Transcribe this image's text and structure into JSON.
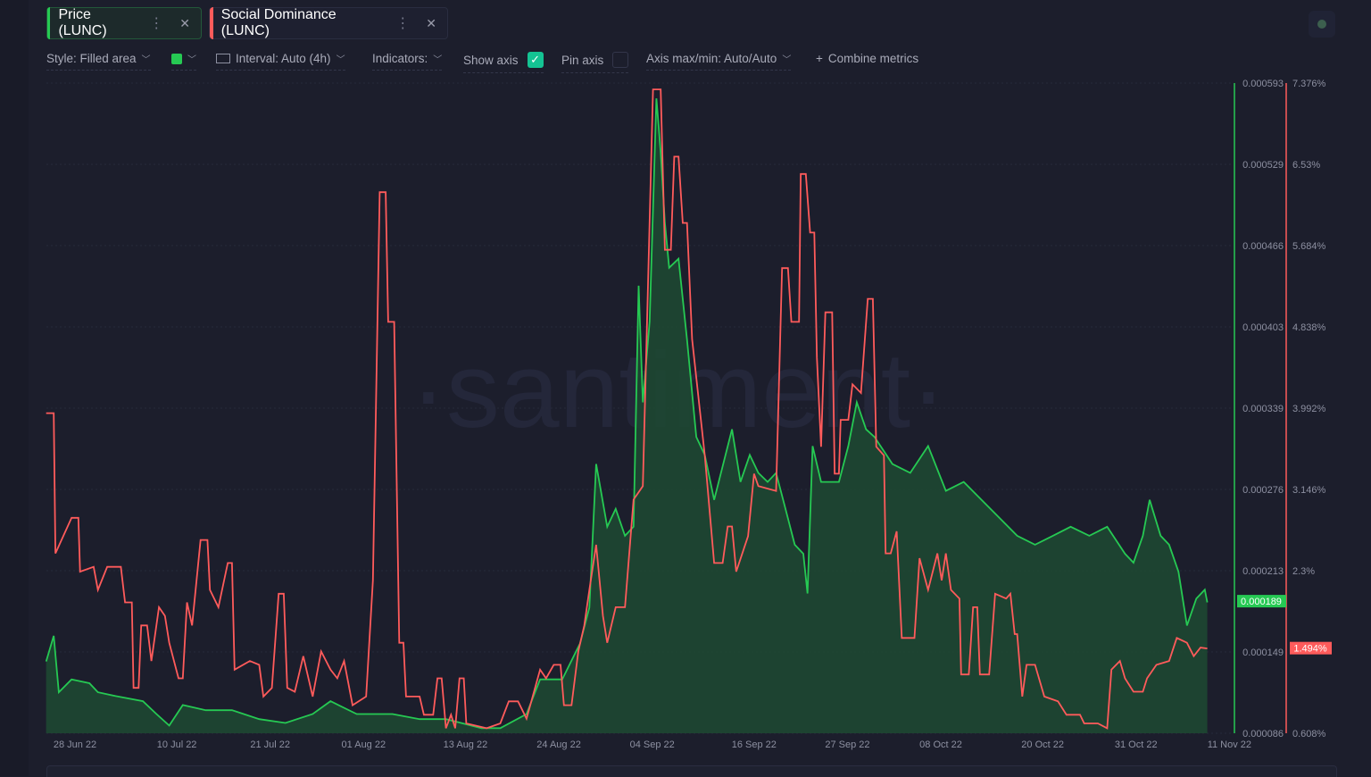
{
  "tabs": [
    {
      "label": "Price (LUNC)",
      "color": "#26c953"
    },
    {
      "label": "Social Dominance (LUNC)",
      "color": "#ff5b5b"
    }
  ],
  "toolbar": {
    "style": "Style: Filled area",
    "interval": "Interval: Auto (4h)",
    "indicators": "Indicators:",
    "show_axis": "Show axis",
    "show_axis_checked": true,
    "pin_axis": "Pin axis",
    "pin_axis_checked": false,
    "axis_maxmin": "Axis max/min: Auto/Auto",
    "combine": "Combine metrics",
    "series_color": "#26c953"
  },
  "watermark": "·santiment·",
  "chart_data": {
    "type": "area",
    "x_unit": "days since 28 Jun 22",
    "x_ticks": [
      {
        "day": 0,
        "label": "28 Jun 22"
      },
      {
        "day": 12,
        "label": "10 Jul 22"
      },
      {
        "day": 23,
        "label": "21 Jul 22"
      },
      {
        "day": 34,
        "label": "01 Aug 22"
      },
      {
        "day": 46,
        "label": "13 Aug 22"
      },
      {
        "day": 57,
        "label": "24 Aug 22"
      },
      {
        "day": 68,
        "label": "04 Sep 22"
      },
      {
        "day": 80,
        "label": "16 Sep 22"
      },
      {
        "day": 91,
        "label": "27 Sep 22"
      },
      {
        "day": 102,
        "label": "08 Oct 22"
      },
      {
        "day": 114,
        "label": "20 Oct 22"
      },
      {
        "day": 125,
        "label": "31 Oct 22"
      },
      {
        "day": 136,
        "label": "11 Nov 22"
      }
    ],
    "price_axis": {
      "min": 8.6e-05,
      "max": 0.000593,
      "ticks": [
        "0.000593",
        "0.000529",
        "0.000466",
        "0.000403",
        "0.000339",
        "0.000276",
        "0.000213",
        "0.000149",
        "0.000086"
      ],
      "current": "0.000189",
      "current_value": 0.000189,
      "color": "#26c953"
    },
    "dominance_axis": {
      "min": 0.608,
      "max": 7.376,
      "ticks": [
        "7.376%",
        "6.53%",
        "5.684%",
        "4.838%",
        "3.992%",
        "3.146%",
        "2.3%",
        "1.494%",
        "0.608%"
      ],
      "tick_values": [
        7.376,
        6.53,
        5.684,
        4.838,
        3.992,
        3.146,
        2.3,
        1.494,
        0.608
      ],
      "current": "1.494%",
      "current_value": 1.494,
      "color": "#ff5b5b"
    },
    "series": [
      {
        "name": "Price (LUNC)",
        "style": "filled-area",
        "color": "#26c953",
        "points": [
          [
            -3.4,
            0.000142
          ],
          [
            -2.5,
            0.000162
          ],
          [
            -1.9,
            0.000118
          ],
          [
            -0.4,
            0.000128
          ],
          [
            1.7,
            0.000125
          ],
          [
            2.7,
            0.000118
          ],
          [
            4.8,
            0.000115
          ],
          [
            8,
            0.000111
          ],
          [
            9.6,
            0.000101
          ],
          [
            11.1,
            9.2e-05
          ],
          [
            12.7,
            0.000108
          ],
          [
            15.4,
            0.000104
          ],
          [
            18.5,
            0.000104
          ],
          [
            21.7,
            9.7e-05
          ],
          [
            24.8,
            9.4e-05
          ],
          [
            28,
            0.000101
          ],
          [
            30.1,
            0.000111
          ],
          [
            33.2,
            0.000101
          ],
          [
            37.4,
            0.000101
          ],
          [
            40.6,
            9.7e-05
          ],
          [
            43.7,
            9.7e-05
          ],
          [
            47.9,
            9e-05
          ],
          [
            50.1,
            9e-05
          ],
          [
            53.2,
            0.000101
          ],
          [
            54.8,
            0.000128
          ],
          [
            57.4,
            0.000128
          ],
          [
            59.5,
            0.000156
          ],
          [
            60.6,
            0.000184
          ],
          [
            61.4,
            0.000296
          ],
          [
            62.7,
            0.000247
          ],
          [
            63.7,
            0.000261
          ],
          [
            64.8,
            0.00024
          ],
          [
            65.8,
            0.000247
          ],
          [
            66.4,
            0.000435
          ],
          [
            66.9,
            0.000344
          ],
          [
            67.7,
            0.000407
          ],
          [
            68.5,
            0.000581
          ],
          [
            69,
            0.000539
          ],
          [
            69.5,
            0.000484
          ],
          [
            70,
            0.000449
          ],
          [
            71.1,
            0.000456
          ],
          [
            72.1,
            0.000393
          ],
          [
            73.2,
            0.000317
          ],
          [
            74.2,
            0.000303
          ],
          [
            75.3,
            0.000268
          ],
          [
            77.4,
            0.000323
          ],
          [
            78.4,
            0.000282
          ],
          [
            79.5,
            0.000303
          ],
          [
            80.5,
            0.000289
          ],
          [
            81.6,
            0.000282
          ],
          [
            82.6,
            0.000289
          ],
          [
            83.7,
            0.000261
          ],
          [
            84.8,
            0.000233
          ],
          [
            85.8,
            0.000226
          ],
          [
            86.3,
            0.000195
          ],
          [
            86.9,
            0.00031
          ],
          [
            87.9,
            0.000282
          ],
          [
            90,
            0.000282
          ],
          [
            91.1,
            0.00031
          ],
          [
            92.1,
            0.000344
          ],
          [
            93.2,
            0.000323
          ],
          [
            94.2,
            0.000317
          ],
          [
            96.3,
            0.000296
          ],
          [
            98.4,
            0.000289
          ],
          [
            100.5,
            0.00031
          ],
          [
            102.6,
            0.000275
          ],
          [
            104.7,
            0.000282
          ],
          [
            106.8,
            0.000268
          ],
          [
            108.9,
            0.000254
          ],
          [
            111,
            0.00024
          ],
          [
            113.1,
            0.000233
          ],
          [
            115.2,
            0.00024
          ],
          [
            117.3,
            0.000247
          ],
          [
            119.5,
            0.00024
          ],
          [
            121.6,
            0.000247
          ],
          [
            123.7,
            0.000226
          ],
          [
            124.7,
            0.000219
          ],
          [
            125.8,
            0.00024
          ],
          [
            126.6,
            0.000268
          ],
          [
            127.9,
            0.00024
          ],
          [
            128.9,
            0.000233
          ],
          [
            130,
            0.000212
          ],
          [
            131,
            0.00017
          ],
          [
            132.1,
            0.000191
          ],
          [
            133.1,
            0.000198
          ],
          [
            133.4,
            0.000188
          ]
        ]
      },
      {
        "name": "Social Dominance (LUNC)",
        "style": "line",
        "color": "#ff5b5b",
        "points": [
          [
            -3.4,
            3.94
          ],
          [
            -2.5,
            3.94
          ],
          [
            -2.3,
            2.48
          ],
          [
            -0.4,
            2.85
          ],
          [
            0.4,
            2.85
          ],
          [
            0.6,
            2.29
          ],
          [
            2.2,
            2.34
          ],
          [
            2.7,
            2.1
          ],
          [
            3.8,
            2.34
          ],
          [
            5.4,
            2.34
          ],
          [
            5.9,
            1.97
          ],
          [
            6.7,
            1.97
          ],
          [
            6.9,
            1.08
          ],
          [
            7.5,
            1.08
          ],
          [
            7.8,
            1.73
          ],
          [
            8.5,
            1.73
          ],
          [
            9,
            1.36
          ],
          [
            9.9,
            1.92
          ],
          [
            10.6,
            1.83
          ],
          [
            11.1,
            1.55
          ],
          [
            12.2,
            1.18
          ],
          [
            12.7,
            1.18
          ],
          [
            13.2,
            1.97
          ],
          [
            13.8,
            1.73
          ],
          [
            14.8,
            2.62
          ],
          [
            15.6,
            2.62
          ],
          [
            15.9,
            2.1
          ],
          [
            16.9,
            1.92
          ],
          [
            18,
            2.38
          ],
          [
            18.5,
            2.38
          ],
          [
            18.8,
            1.27
          ],
          [
            20.6,
            1.36
          ],
          [
            21.7,
            1.32
          ],
          [
            22.2,
            0.99
          ],
          [
            23.2,
            1.08
          ],
          [
            24,
            2.06
          ],
          [
            24.6,
            2.06
          ],
          [
            25,
            1.08
          ],
          [
            25.9,
            1.04
          ],
          [
            26.9,
            1.41
          ],
          [
            28,
            0.99
          ],
          [
            29,
            1.46
          ],
          [
            30.1,
            1.27
          ],
          [
            30.9,
            1.18
          ],
          [
            31.7,
            1.36
          ],
          [
            32.7,
            0.9
          ],
          [
            34.3,
            0.99
          ],
          [
            35.1,
            2.2
          ],
          [
            35.9,
            6.24
          ],
          [
            36.6,
            6.24
          ],
          [
            36.9,
            4.89
          ],
          [
            37.6,
            4.89
          ],
          [
            38.2,
            1.55
          ],
          [
            38.7,
            1.55
          ],
          [
            39,
            0.99
          ],
          [
            40.6,
            0.99
          ],
          [
            41.1,
            0.8
          ],
          [
            42.2,
            0.8
          ],
          [
            42.7,
            1.18
          ],
          [
            43.2,
            1.18
          ],
          [
            43.7,
            0.66
          ],
          [
            44.3,
            0.8
          ],
          [
            44.8,
            0.66
          ],
          [
            45.3,
            1.18
          ],
          [
            45.8,
            1.18
          ],
          [
            46.1,
            0.71
          ],
          [
            48.5,
            0.66
          ],
          [
            50.1,
            0.71
          ],
          [
            51.1,
            0.94
          ],
          [
            52.2,
            0.94
          ],
          [
            53.2,
            0.76
          ],
          [
            54.8,
            1.27
          ],
          [
            55.5,
            1.18
          ],
          [
            56.4,
            1.32
          ],
          [
            57.2,
            1.32
          ],
          [
            57.6,
            0.9
          ],
          [
            58.5,
            0.9
          ],
          [
            59.3,
            1.46
          ],
          [
            60,
            1.73
          ],
          [
            60.6,
            2.1
          ],
          [
            61.4,
            2.57
          ],
          [
            62.2,
            1.83
          ],
          [
            62.7,
            1.55
          ],
          [
            63.7,
            1.92
          ],
          [
            64.8,
            1.92
          ],
          [
            65.8,
            3.04
          ],
          [
            66.9,
            3.18
          ],
          [
            68.1,
            7.31
          ],
          [
            69,
            7.31
          ],
          [
            69.5,
            5.64
          ],
          [
            70.2,
            5.64
          ],
          [
            70.6,
            6.61
          ],
          [
            71.1,
            6.61
          ],
          [
            71.6,
            5.92
          ],
          [
            72.1,
            5.92
          ],
          [
            72.7,
            4.71
          ],
          [
            74.2,
            3.5
          ],
          [
            75.3,
            2.38
          ],
          [
            76.3,
            2.38
          ],
          [
            76.9,
            2.76
          ],
          [
            77.4,
            2.76
          ],
          [
            77.9,
            2.29
          ],
          [
            79.3,
            2.66
          ],
          [
            80,
            3.31
          ],
          [
            80.5,
            3.18
          ],
          [
            82.6,
            3.13
          ],
          [
            83.3,
            5.45
          ],
          [
            84,
            5.45
          ],
          [
            84.4,
            4.89
          ],
          [
            85.3,
            4.89
          ],
          [
            85.5,
            6.43
          ],
          [
            86.1,
            6.43
          ],
          [
            86.6,
            5.82
          ],
          [
            87.1,
            5.82
          ],
          [
            87.4,
            4.52
          ],
          [
            87.9,
            3.59
          ],
          [
            88.4,
            4.99
          ],
          [
            89.2,
            4.99
          ],
          [
            89.5,
            3.31
          ],
          [
            90,
            3.31
          ],
          [
            90.2,
            3.87
          ],
          [
            91.1,
            3.87
          ],
          [
            91.6,
            4.24
          ],
          [
            92.6,
            4.15
          ],
          [
            93.4,
            5.13
          ],
          [
            94,
            5.13
          ],
          [
            94.4,
            3.59
          ],
          [
            95.3,
            3.5
          ],
          [
            95.5,
            2.48
          ],
          [
            96.1,
            2.48
          ],
          [
            96.8,
            2.71
          ],
          [
            97.4,
            1.6
          ],
          [
            98.9,
            1.6
          ],
          [
            99.5,
            2.43
          ],
          [
            100.5,
            2.1
          ],
          [
            101.6,
            2.48
          ],
          [
            102.1,
            2.2
          ],
          [
            102.6,
            2.48
          ],
          [
            103.2,
            2.1
          ],
          [
            104.2,
            2.01
          ],
          [
            104.4,
            1.22
          ],
          [
            105.3,
            1.22
          ],
          [
            105.8,
            1.92
          ],
          [
            106.3,
            1.92
          ],
          [
            106.6,
            1.22
          ],
          [
            107.7,
            1.22
          ],
          [
            108.4,
            2.06
          ],
          [
            109.7,
            2.01
          ],
          [
            110.2,
            2.06
          ],
          [
            110.7,
            1.64
          ],
          [
            111,
            1.64
          ],
          [
            111.6,
            0.99
          ],
          [
            112.1,
            1.32
          ],
          [
            113.1,
            1.32
          ],
          [
            114.2,
            0.99
          ],
          [
            115.8,
            0.94
          ],
          [
            116.8,
            0.8
          ],
          [
            118.4,
            0.8
          ],
          [
            118.9,
            0.71
          ],
          [
            120.5,
            0.71
          ],
          [
            121.6,
            0.66
          ],
          [
            122.1,
            1.27
          ],
          [
            123.1,
            1.36
          ],
          [
            123.7,
            1.18
          ],
          [
            124.7,
            1.04
          ],
          [
            125.8,
            1.04
          ],
          [
            126.3,
            1.18
          ],
          [
            127.4,
            1.32
          ],
          [
            128.9,
            1.36
          ],
          [
            129.8,
            1.6
          ],
          [
            131,
            1.55
          ],
          [
            131.8,
            1.41
          ],
          [
            132.6,
            1.5
          ],
          [
            133.4,
            1.49
          ]
        ]
      }
    ],
    "grid": true,
    "legend": "top-left tabs"
  }
}
